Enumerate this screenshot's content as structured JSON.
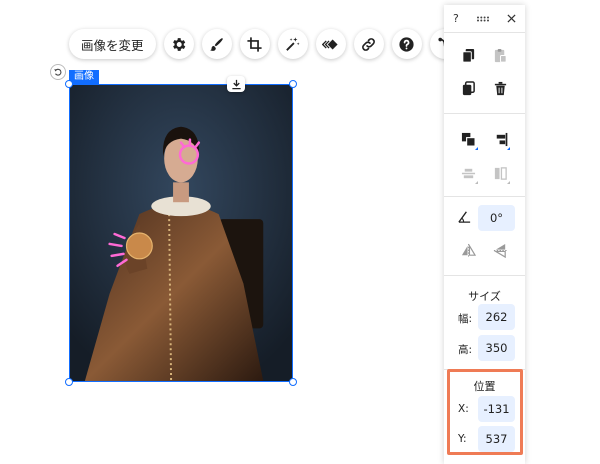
{
  "toolbar": {
    "change_image_label": "画像を変更",
    "buttons": [
      "settings-icon",
      "brush-icon",
      "crop-icon",
      "magic-wand-icon",
      "animation-icon",
      "link-icon",
      "help-icon",
      "connector-icon"
    ]
  },
  "element": {
    "tag_label": "画像"
  },
  "panel": {
    "help_label": "?",
    "rotation": {
      "value": "0°"
    },
    "size": {
      "title": "サイズ",
      "width_label": "幅:",
      "width_value": "262",
      "height_label": "高:",
      "height_value": "350"
    },
    "position": {
      "title": "位置",
      "x_label": "X:",
      "x_value": "-131",
      "y_label": "Y:",
      "y_value": "537"
    }
  },
  "colors": {
    "accent": "#116dff",
    "field_bg": "#e7f0ff",
    "highlight": "#ef7b55"
  }
}
